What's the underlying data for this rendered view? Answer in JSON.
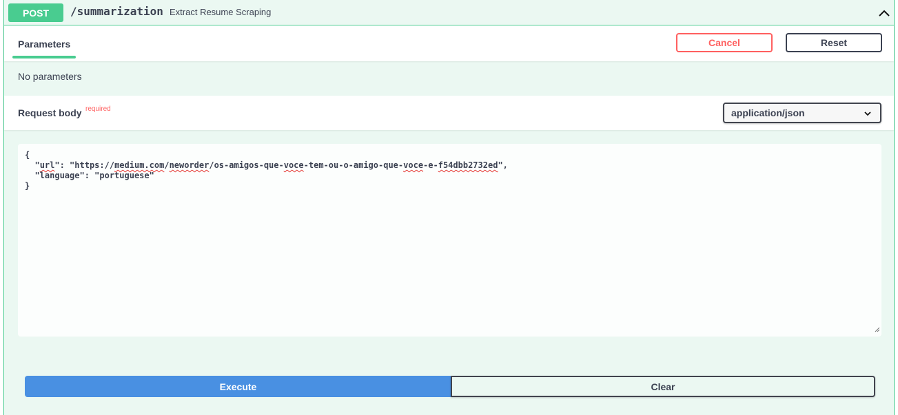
{
  "summary": {
    "method": "POST",
    "path": "/summarization",
    "description": "Extract Resume Scraping",
    "collapse_icon": "chevron-up-icon"
  },
  "parameters": {
    "tab_label": "Parameters",
    "cancel_label": "Cancel",
    "reset_label": "Reset",
    "empty_text": "No parameters"
  },
  "request_body": {
    "title": "Request body",
    "required_label": "required",
    "content_type": "application/json",
    "dropdown_icon": "chevron-down-icon",
    "json_lines": [
      "{",
      "  \"url\": \"https://medium.com/neworder/os-amigos-que-voce-tem-ou-o-amigo-que-voce-e-f54dbb2732ed\",",
      "  \"language\": \"portuguese\"",
      "}"
    ]
  },
  "actions": {
    "execute_label": "Execute",
    "clear_label": "Clear"
  },
  "colors": {
    "method_post": "#49cc90",
    "background": "#ebf8f2",
    "execute": "#4990e2",
    "cancel": "#ff6060",
    "required": "#ff6060"
  }
}
